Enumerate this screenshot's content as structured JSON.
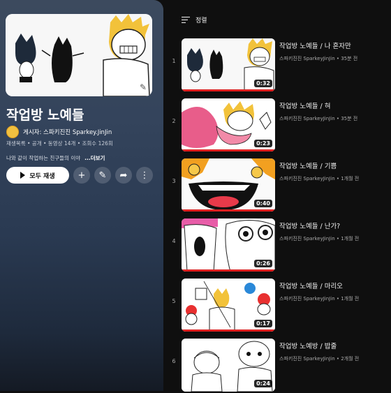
{
  "playlist": {
    "title": "작업방 노예들",
    "owner": "게시자: 스파키진진 Sparkey.JinJin",
    "meta": "재생목록 • 공개 • 동영상 14개 • 조회수 126회",
    "description": "나와 같이 작업하는 친구들의 이야",
    "more_label": "...더보기",
    "play_all_label": "모두 재생"
  },
  "sort": {
    "label": "정렬"
  },
  "videos": [
    {
      "index": "1",
      "title": "작업방 노예들 / 나 혼자만",
      "meta": "스파키진진 SparkeyJinJin • 35분 전",
      "duration": "0:32"
    },
    {
      "index": "2",
      "title": "작업방 노예들 / 혀",
      "meta": "스파키진진 SparkeyJinJin • 35분 전",
      "duration": "0:23"
    },
    {
      "index": "3",
      "title": "작업방 노예들 / 기쁨",
      "meta": "스파키진진 SparkeyJinJin • 1개월 전",
      "duration": "0:40"
    },
    {
      "index": "4",
      "title": "작업방 노예들 / 난가?",
      "meta": "스파키진진 SparkeyJinJin • 1개월 전",
      "duration": "0:26"
    },
    {
      "index": "5",
      "title": "작업방 노예들 / 마리오",
      "meta": "스파키진진 SparkeyJinJin • 1개월 전",
      "duration": "0:17"
    },
    {
      "index": "6",
      "title": "작업방 노예방 / 밥줄",
      "meta": "스파키진진 SparkeyJinJin • 2개월 전",
      "duration": "0:24"
    }
  ],
  "colors": {
    "progress": "#e02020",
    "background": "#0f0f0f"
  }
}
